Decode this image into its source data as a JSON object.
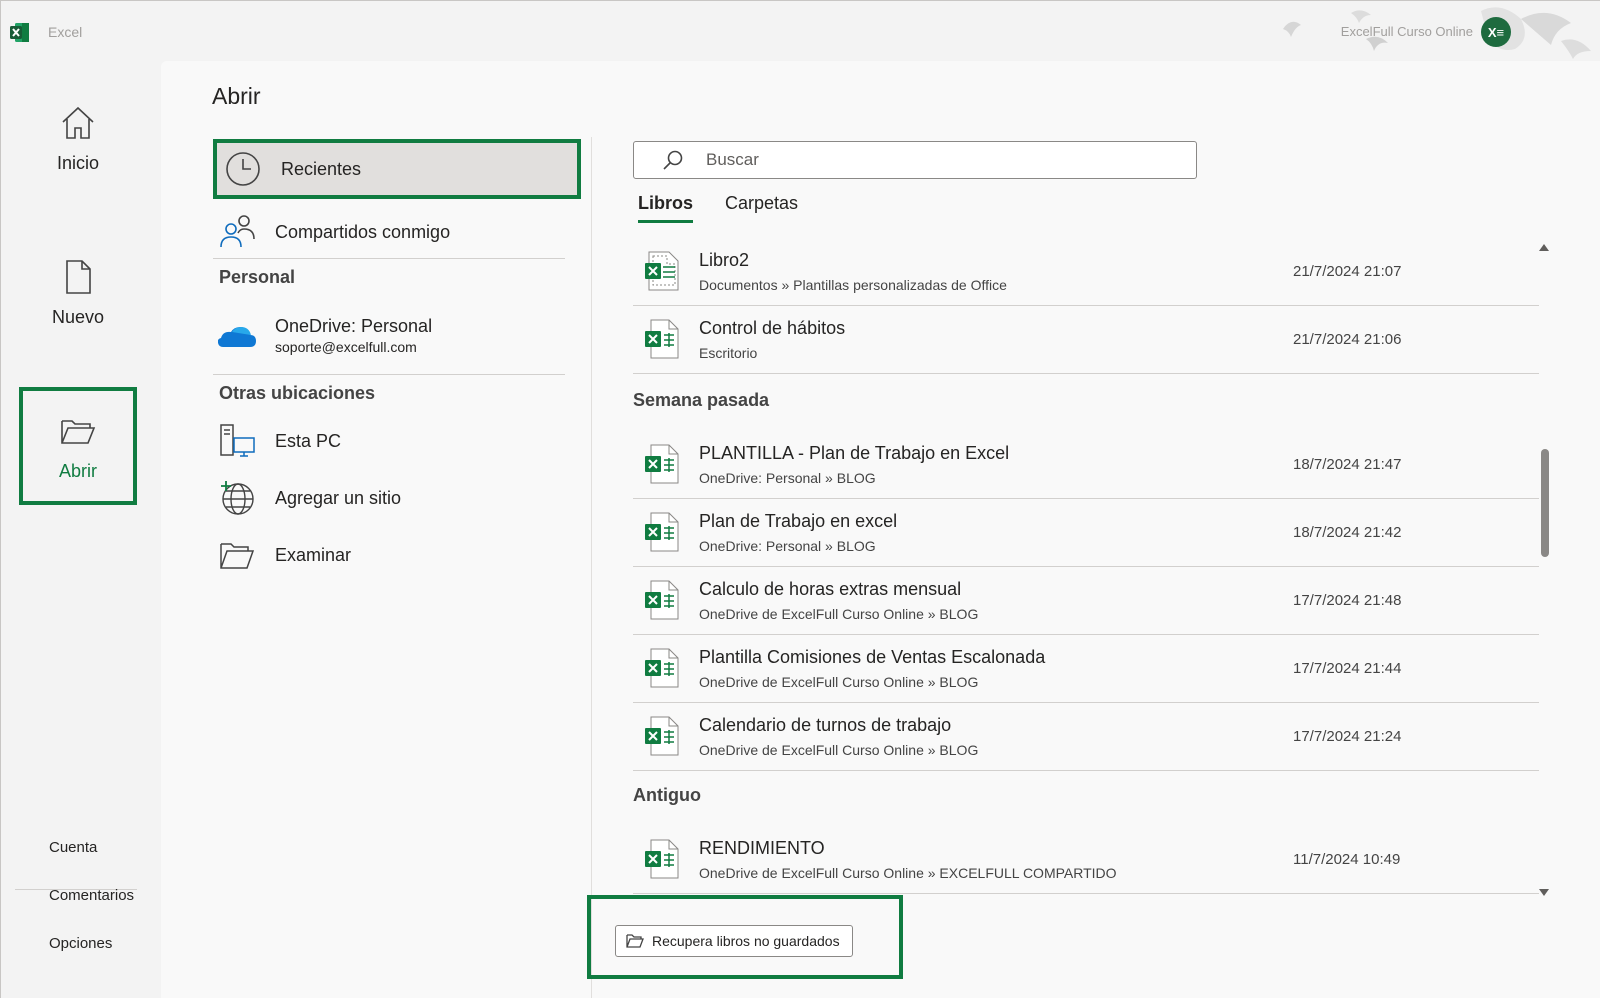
{
  "window": {
    "app_name": "Excel",
    "account_name": "ExcelFull Curso Online",
    "avatar_text": "X≡"
  },
  "nav": {
    "home": "Inicio",
    "new": "Nuevo",
    "open": "Abrir",
    "account": "Cuenta",
    "feedback": "Comentarios",
    "options": "Opciones"
  },
  "page": {
    "title": "Abrir"
  },
  "locations": {
    "recent": "Recientes",
    "shared": "Compartidos conmigo",
    "personal_heading": "Personal",
    "onedrive_name": "OneDrive: Personal",
    "onedrive_email": "soporte@excelfull.com",
    "other_heading": "Otras ubicaciones",
    "this_pc": "Esta PC",
    "add_place": "Agregar un sitio",
    "browse": "Examinar"
  },
  "search": {
    "placeholder": "Buscar"
  },
  "tabs": {
    "books": "Libros",
    "folders": "Carpetas"
  },
  "files": {
    "recent": [
      {
        "name": "Libro2",
        "path": "Documentos » Plantillas personalizadas de Office",
        "date": "21/7/2024 21:07"
      },
      {
        "name": "Control de hábitos",
        "path": "Escritorio",
        "date": "21/7/2024 21:06"
      }
    ],
    "last_week_title": "Semana pasada",
    "last_week": [
      {
        "name": "PLANTILLA - Plan de Trabajo en Excel",
        "path": "OneDrive: Personal » BLOG",
        "date": "18/7/2024 21:47"
      },
      {
        "name": "Plan de Trabajo en excel",
        "path": "OneDrive: Personal » BLOG",
        "date": "18/7/2024 21:42"
      },
      {
        "name": "Calculo de horas extras mensual",
        "path": "OneDrive de ExcelFull Curso Online » BLOG",
        "date": "17/7/2024 21:48"
      },
      {
        "name": "Plantilla Comisiones de Ventas Escalonada",
        "path": "OneDrive de ExcelFull Curso Online » BLOG",
        "date": "17/7/2024 21:44"
      },
      {
        "name": "Calendario de turnos de trabajo",
        "path": "OneDrive de ExcelFull Curso Online » BLOG",
        "date": "17/7/2024 21:24"
      }
    ],
    "older_title": "Antiguo",
    "older": [
      {
        "name": "RENDIMIENTO",
        "path": "OneDrive de ExcelFull Curso Online » EXCELFULL COMPARTIDO",
        "date": "11/7/2024 10:49"
      }
    ]
  },
  "recover_button": "Recupera libros no guardados",
  "colors": {
    "accent": "#107c41",
    "background": "#f3f3f3",
    "panel": "#f9f9f9"
  }
}
